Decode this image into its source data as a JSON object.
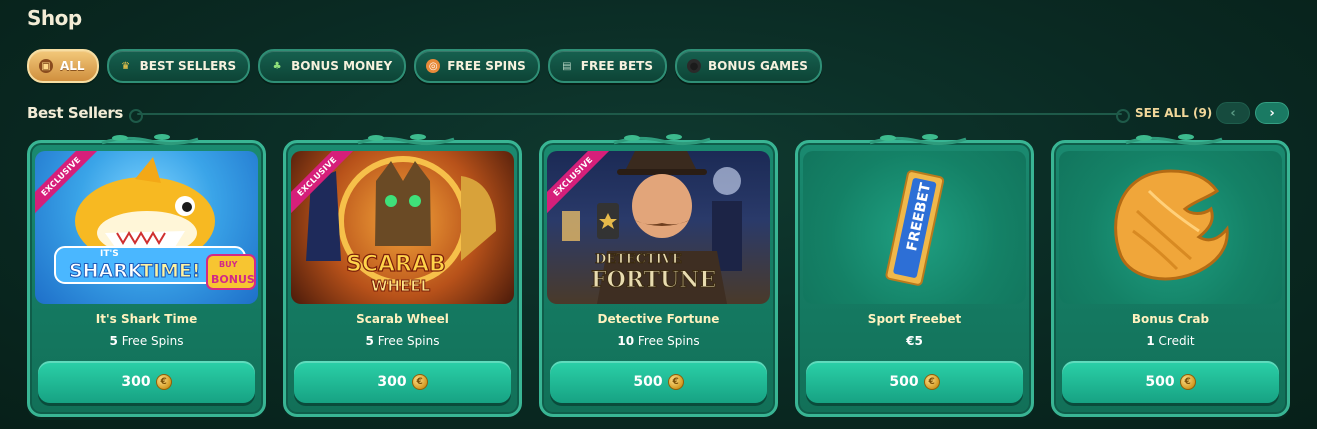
{
  "page": {
    "title": "Shop"
  },
  "filters": [
    {
      "label": "ALL",
      "icon": "chest-icon",
      "active": true
    },
    {
      "label": "BEST SELLERS",
      "icon": "trophy-icon",
      "active": false
    },
    {
      "label": "BONUS MONEY",
      "icon": "clover-icon",
      "active": false
    },
    {
      "label": "FREE SPINS",
      "icon": "spin-icon",
      "active": false
    },
    {
      "label": "FREE BETS",
      "icon": "ticket-icon",
      "active": false
    },
    {
      "label": "BONUS GAMES",
      "icon": "bomb-icon",
      "active": false
    }
  ],
  "section": {
    "title": "Best Sellers",
    "see_all": "SEE ALL (9)",
    "prev": "‹",
    "next": "›"
  },
  "cards": [
    {
      "name": "It's Shark Time",
      "qty": "5",
      "unit": "Free Spins",
      "price": "300",
      "badge": "EXCLUSIVE",
      "image": "shark-time-game-art"
    },
    {
      "name": "Scarab Wheel",
      "qty": "5",
      "unit": "Free Spins",
      "price": "300",
      "badge": "EXCLUSIVE",
      "image": "scarab-wheel-game-art"
    },
    {
      "name": "Detective Fortune",
      "qty": "10",
      "unit": "Free Spins",
      "price": "500",
      "badge": "EXCLUSIVE",
      "image": "detective-fortune-game-art"
    },
    {
      "name": "Sport Freebet",
      "qty": "€5",
      "unit": "",
      "price": "500",
      "badge": "",
      "image": "freebet-ticket-icon"
    },
    {
      "name": "Bonus Crab",
      "qty": "1",
      "unit": "Credit",
      "price": "500",
      "badge": "",
      "image": "bonus-crab-icon"
    }
  ],
  "art_text": {
    "shark": [
      "IT'S",
      "SHARK",
      "TIME!",
      "BUY",
      "BONUS"
    ],
    "scarab": [
      "SCARAB",
      "WHEEL"
    ],
    "detective": [
      "DETECTIVE",
      "FORTUNE"
    ],
    "freebet": "FREEBET"
  },
  "colors": {
    "background": "#0a2a23",
    "card": "#157a62",
    "card_border": "#39b594",
    "active_chip": "#e0a85a",
    "price_button": "#22bb96",
    "exclusive_ribbon": "#d61f7a",
    "coin": "#d39a22"
  }
}
